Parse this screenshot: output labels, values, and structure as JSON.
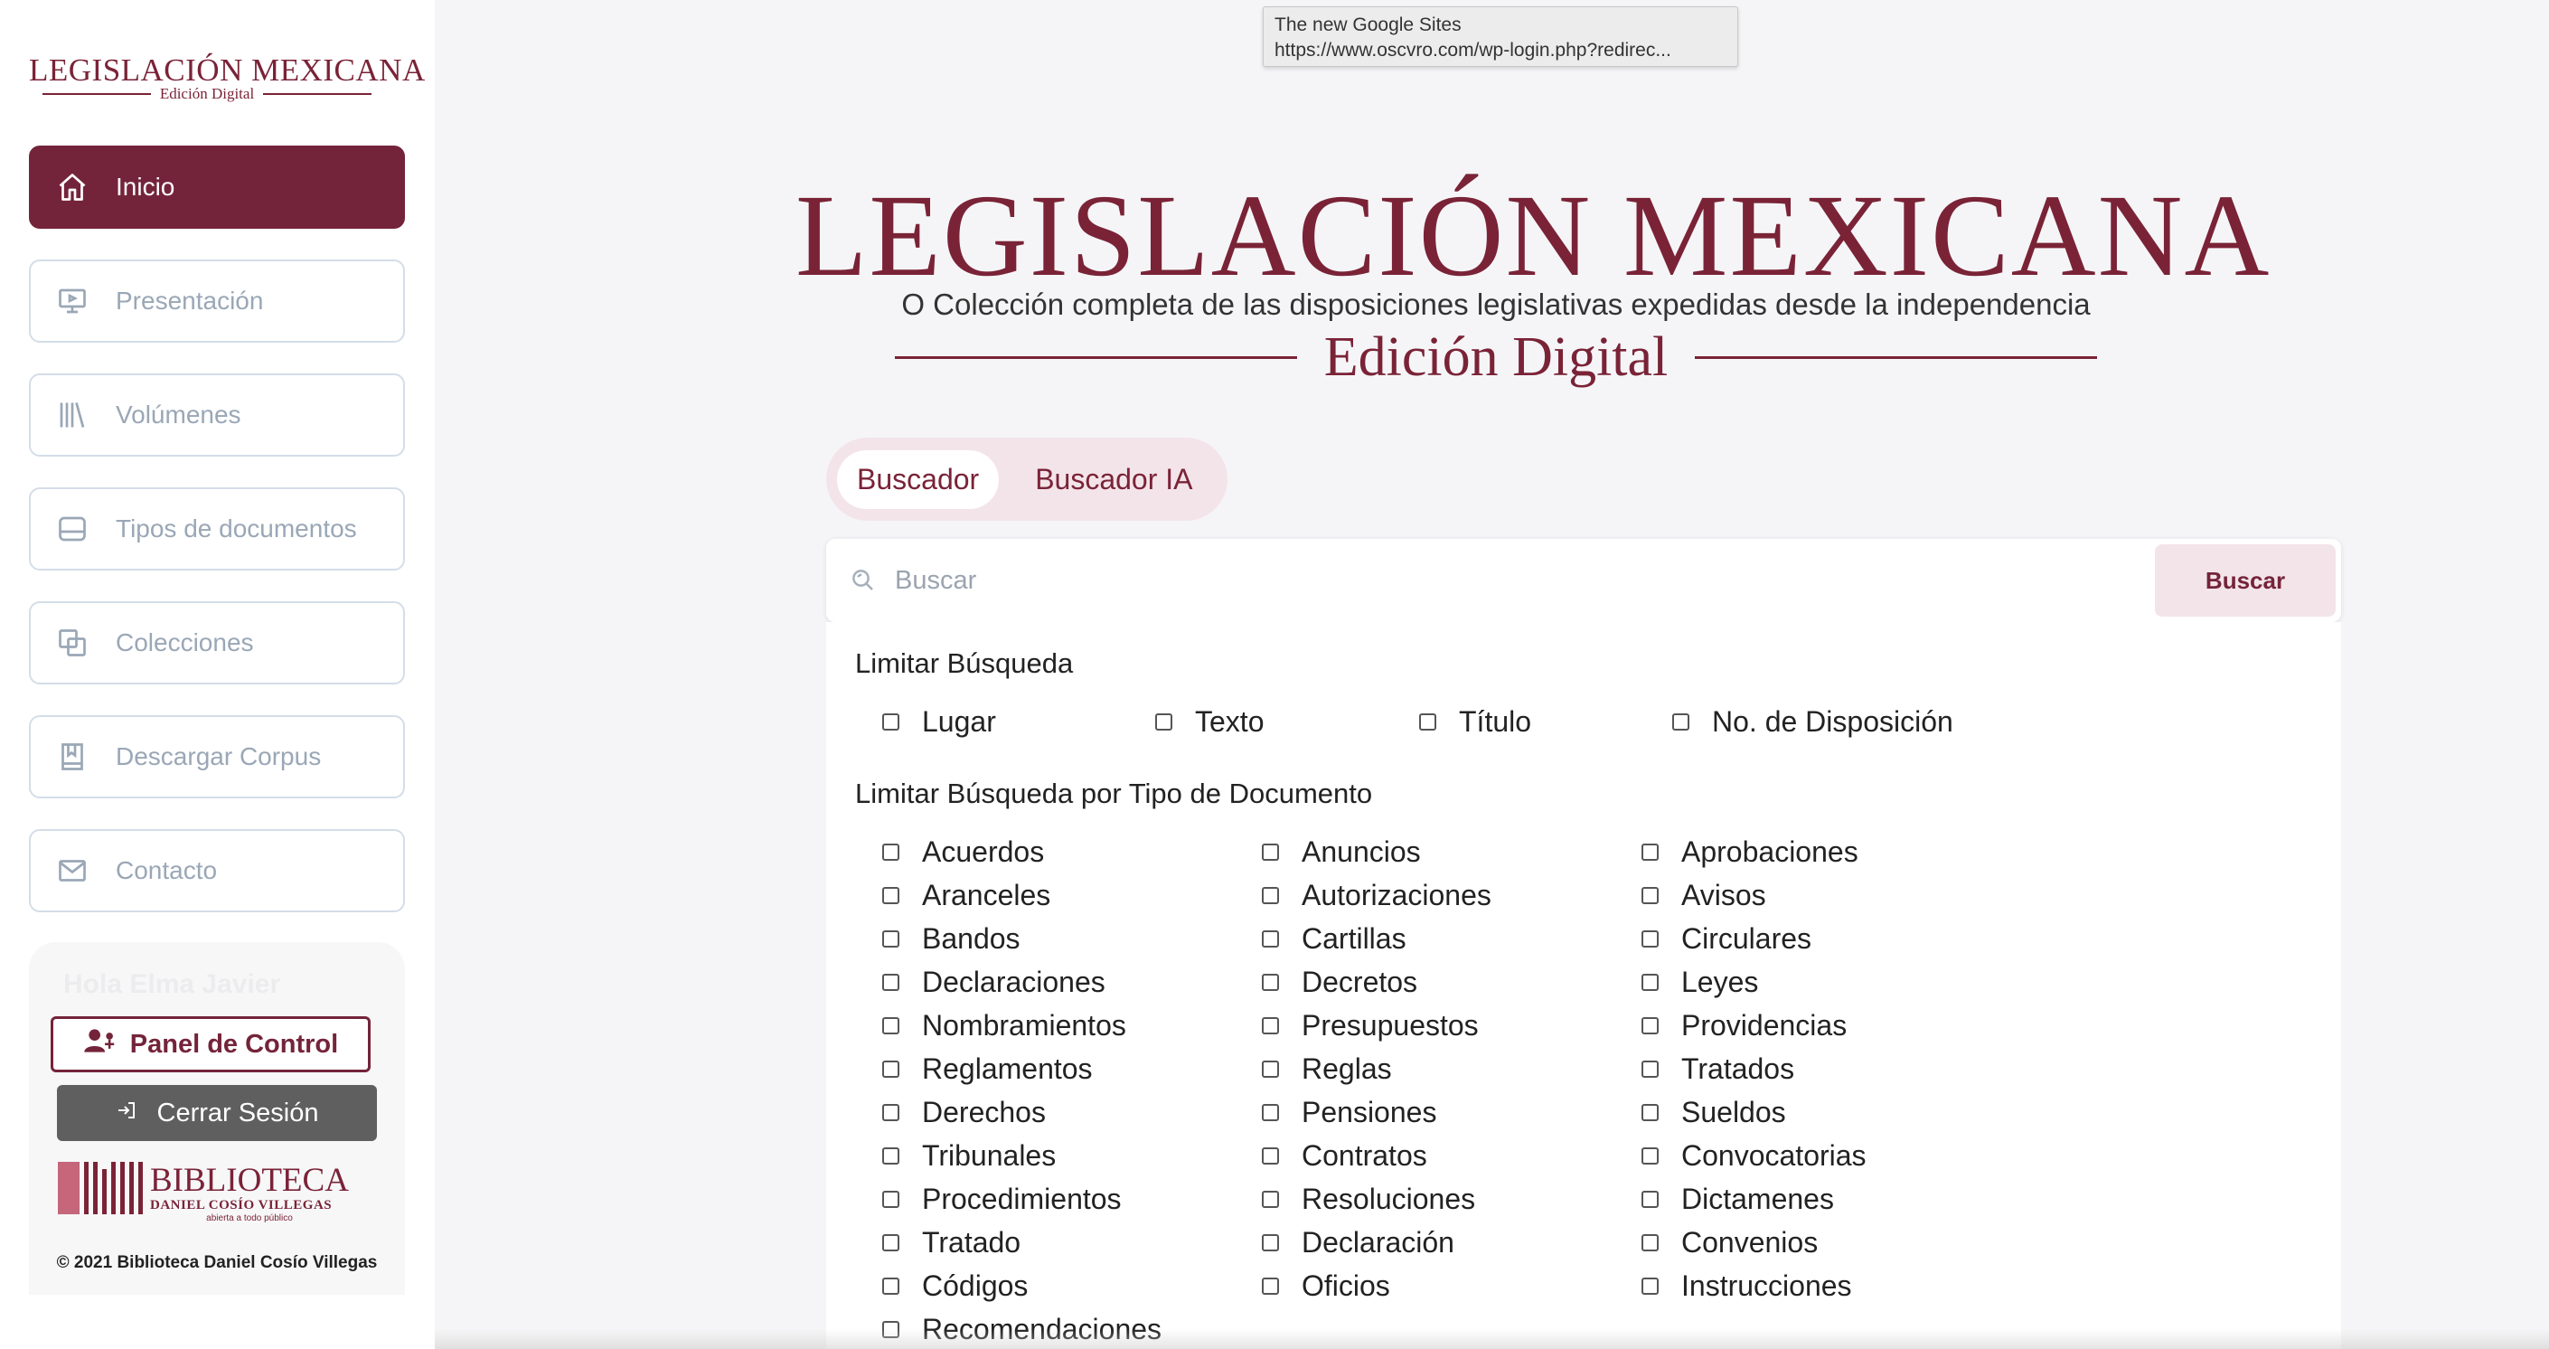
{
  "sidebar": {
    "logo": {
      "line1": "LEGISLACIÓN MEXICANA",
      "line2": "Edición Digital"
    },
    "items": [
      {
        "label": "Inicio",
        "icon": "home-icon",
        "active": true
      },
      {
        "label": "Presentación",
        "icon": "presentation-icon"
      },
      {
        "label": "Volúmenes",
        "icon": "books-icon"
      },
      {
        "label": "Tipos de documentos",
        "icon": "document-types-icon"
      },
      {
        "label": "Colecciones",
        "icon": "collections-icon"
      },
      {
        "label": "Descargar Corpus",
        "icon": "download-book-icon"
      },
      {
        "label": "Contacto",
        "icon": "mail-icon"
      }
    ],
    "user": {
      "greeting": "Hola Elma Javier",
      "panel_label": "Panel de Control",
      "logout_label": "Cerrar Sesión"
    },
    "library": {
      "name": "BIBLIOTECA",
      "subtitle": "DANIEL COSÍO VILLEGAS",
      "tagline": "abierta a todo público"
    },
    "copyright": "© 2021 Biblioteca Daniel Cosío Villegas"
  },
  "tooltip": {
    "title": "The new Google Sites",
    "url": "https://www.oscvro.com/wp-login.php?redirec..."
  },
  "hero": {
    "title": "LEGISLACIÓN MEXICANA",
    "subtitle": "O Colección completa de las disposiciones legislativas expedidas desde la independencia",
    "edition": "Edición Digital"
  },
  "tabs": [
    {
      "label": "Buscador",
      "active": true
    },
    {
      "label": "Buscador IA"
    }
  ],
  "search": {
    "placeholder": "Buscar",
    "button_label": "Buscar"
  },
  "limit": {
    "title": "Limitar Búsqueda",
    "options": [
      "Lugar",
      "Texto",
      "Título",
      "No. de Disposición"
    ]
  },
  "doc_types": {
    "title": "Limitar Búsqueda por Tipo de Documento",
    "options": [
      "Acuerdos",
      "Anuncios",
      "Aprobaciones",
      "Aranceles",
      "Autorizaciones",
      "Avisos",
      "Bandos",
      "Cartillas",
      "Circulares",
      "Declaraciones",
      "Decretos",
      "Leyes",
      "Nombramientos",
      "Presupuestos",
      "Providencias",
      "Reglamentos",
      "Reglas",
      "Tratados",
      "Derechos",
      "Pensiones",
      "Sueldos",
      "Tribunales",
      "Contratos",
      "Convocatorias",
      "Procedimientos",
      "Resoluciones",
      "Dictamenes",
      "Tratado",
      "Declaración",
      "Convenios",
      "Códigos",
      "Oficios",
      "Instrucciones",
      "Recomendaciones"
    ]
  },
  "colors": {
    "brand": "#74243a",
    "brand_light": "#f3e4ea",
    "muted": "#9aa7b6"
  }
}
